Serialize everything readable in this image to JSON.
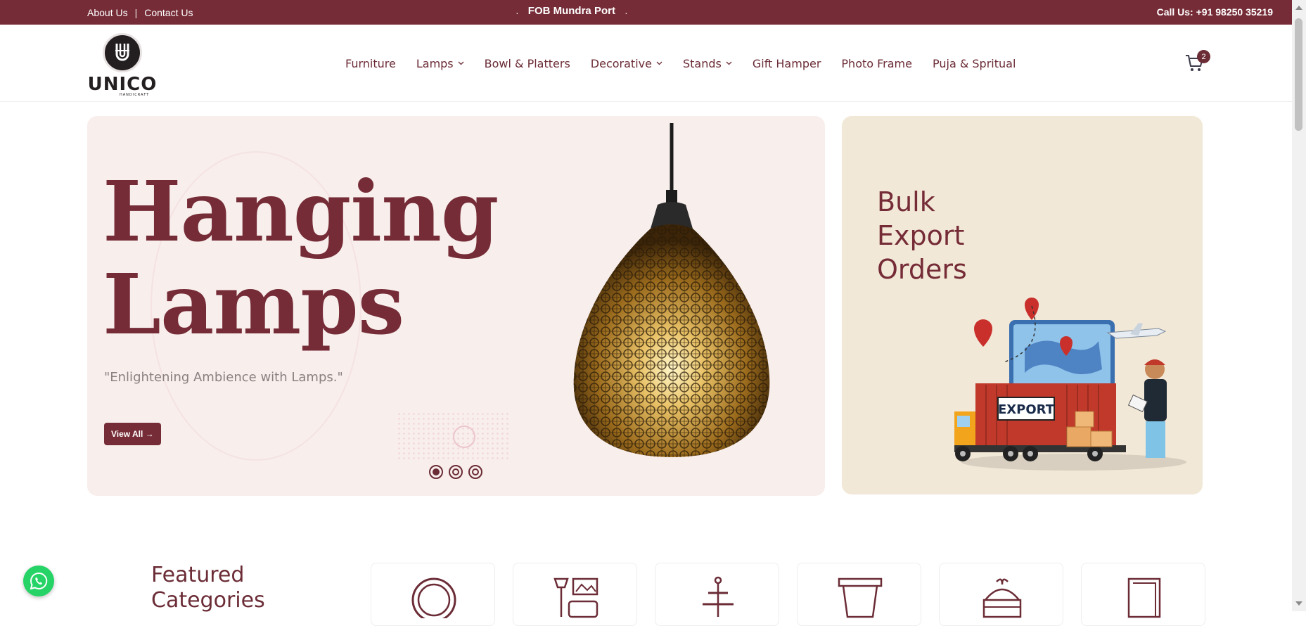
{
  "topbar": {
    "about": "About Us",
    "separator": "|",
    "contact": "Contact Us",
    "center_dot_left": ".",
    "center_text": "FOB Mundra Port",
    "center_dot_right": ".",
    "call": "Call Us: +91 98250 35219"
  },
  "header": {
    "logo_text": "UNICO",
    "logo_sub": "HANDICRAFT",
    "nav": [
      {
        "label": "Furniture",
        "dropdown": false
      },
      {
        "label": "Lamps",
        "dropdown": true
      },
      {
        "label": "Bowl & Platters",
        "dropdown": false
      },
      {
        "label": "Decorative",
        "dropdown": true
      },
      {
        "label": "Stands",
        "dropdown": true
      },
      {
        "label": "Gift Hamper",
        "dropdown": false
      },
      {
        "label": "Photo Frame",
        "dropdown": false
      },
      {
        "label": "Puja & Spritual",
        "dropdown": false
      }
    ],
    "cart_count": "2",
    "chevron": "⌄"
  },
  "hero": {
    "title_line1": "Hanging",
    "title_line2": "Lamps",
    "tagline": "\"Enlightening Ambience with Lamps.\"",
    "button": "View All →",
    "slides": 3,
    "active_slide": 1
  },
  "export_card": {
    "line1": "Bulk",
    "line2": "Export",
    "line3": "Orders",
    "truck_label": "EXPORT"
  },
  "featured": {
    "title_line1": "Featured",
    "title_line2": "Categories"
  },
  "colors": {
    "brand": "#752c37",
    "hero_bg": "#f8eeec",
    "export_bg": "#f2e8d7"
  }
}
